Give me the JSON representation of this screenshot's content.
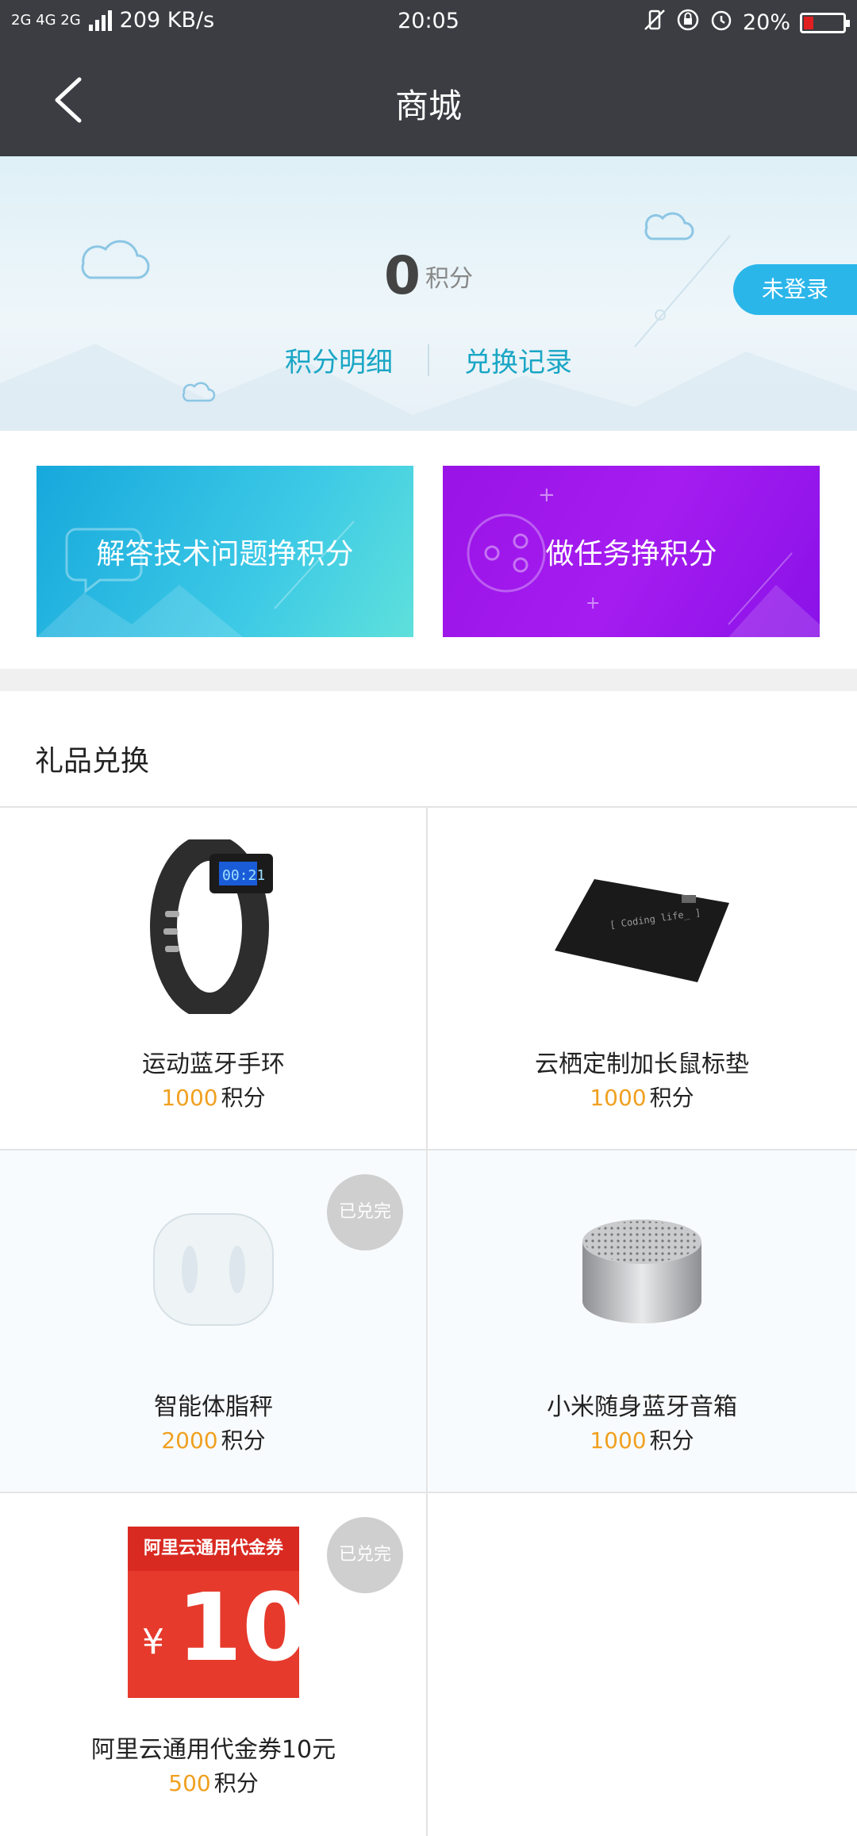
{
  "status_bar": {
    "network": "2G 4G 2G",
    "speed": "209 KB/s",
    "time": "20:05",
    "battery": "20%"
  },
  "header": {
    "title": "商城"
  },
  "points": {
    "value": "0",
    "unit": "积分",
    "detail_link": "积分明细",
    "exchange_link": "兑换记录",
    "login_button": "未登录"
  },
  "tasks": [
    {
      "label": "解答技术问题挣积分"
    },
    {
      "label": "做任务挣积分"
    }
  ],
  "gifts": {
    "title": "礼品兑换",
    "items": [
      {
        "name": "运动蓝牙手环",
        "points": "1000",
        "unit": "积分",
        "soldout": ""
      },
      {
        "name": "云栖定制加长鼠标垫",
        "points": "1000",
        "unit": "积分",
        "soldout": ""
      },
      {
        "name": "智能体脂秤",
        "points": "2000",
        "unit": "积分",
        "soldout": "已兑完"
      },
      {
        "name": "小米随身蓝牙音箱",
        "points": "1000",
        "unit": "积分",
        "soldout": ""
      },
      {
        "name": "阿里云通用代金券10元",
        "points": "500",
        "unit": "积分",
        "soldout": "已兑完"
      }
    ],
    "coupon": {
      "header": "阿里云通用代金券",
      "currency": "¥",
      "amount": "10"
    },
    "mousepad_text": "[ Coding life_ ]"
  },
  "colors": {
    "titlebar": "#3b3d42",
    "accent": "#19a6c5",
    "price": "#f0a020"
  }
}
